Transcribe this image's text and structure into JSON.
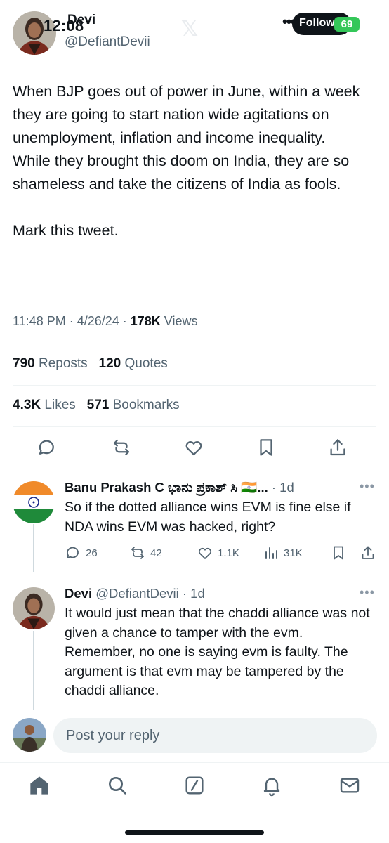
{
  "status_bar": {
    "time": "12:08",
    "battery": "69"
  },
  "tweet": {
    "author_name": "Devi",
    "author_handle": "@DefiantDevii",
    "follow_label": "Follow",
    "body_paragraphs": [
      "When BJP goes out of power in June, within a week they are going to start nation wide agitations on unemployment, inflation and income inequality.",
      "While they brought this doom on India, they are so shameless and take the citizens of India as fools.",
      "",
      "Mark this tweet."
    ],
    "timestamp": "11:48 PM · 4/26/24 · ",
    "views_count": "178K",
    "views_label": " Views",
    "reposts_count": "790",
    "reposts_label": " Reposts",
    "quotes_count": "120",
    "quotes_label": " Quotes",
    "likes_count": "4.3K",
    "likes_label": " Likes",
    "bookmarks_count": "571",
    "bookmarks_label": " Bookmarks"
  },
  "replies": [
    {
      "name": "Banu Prakash C ಭಾನು ಪ್ರಕಾಶ್ ಸಿ 🇮🇳...",
      "meta": " · 1d",
      "text": "So if the dotted alliance wins EVM is fine else if NDA wins EVM was hacked, right?",
      "stats": {
        "replies": "26",
        "reposts": "42",
        "likes": "1.1K",
        "views": "31K"
      }
    },
    {
      "name": "Devi",
      "meta": " @DefiantDevii · 1d",
      "text": "It would just mean that the chaddi alliance was not given a chance to tamper with the evm. Remember, no one is saying evm is faulty. The argument is that evm may be tampered by the chaddi alliance."
    }
  ],
  "composer": {
    "placeholder": "Post your reply"
  },
  "colors": {
    "text": "#0f1419",
    "secondary": "#536471",
    "divider": "#eff3f4",
    "battery": "#34c759"
  },
  "icons": [
    "reply-icon",
    "repost-icon",
    "like-icon",
    "bookmark-icon",
    "share-icon",
    "views-icon",
    "home-icon",
    "search-icon",
    "grok-icon",
    "notifications-icon",
    "messages-icon"
  ]
}
